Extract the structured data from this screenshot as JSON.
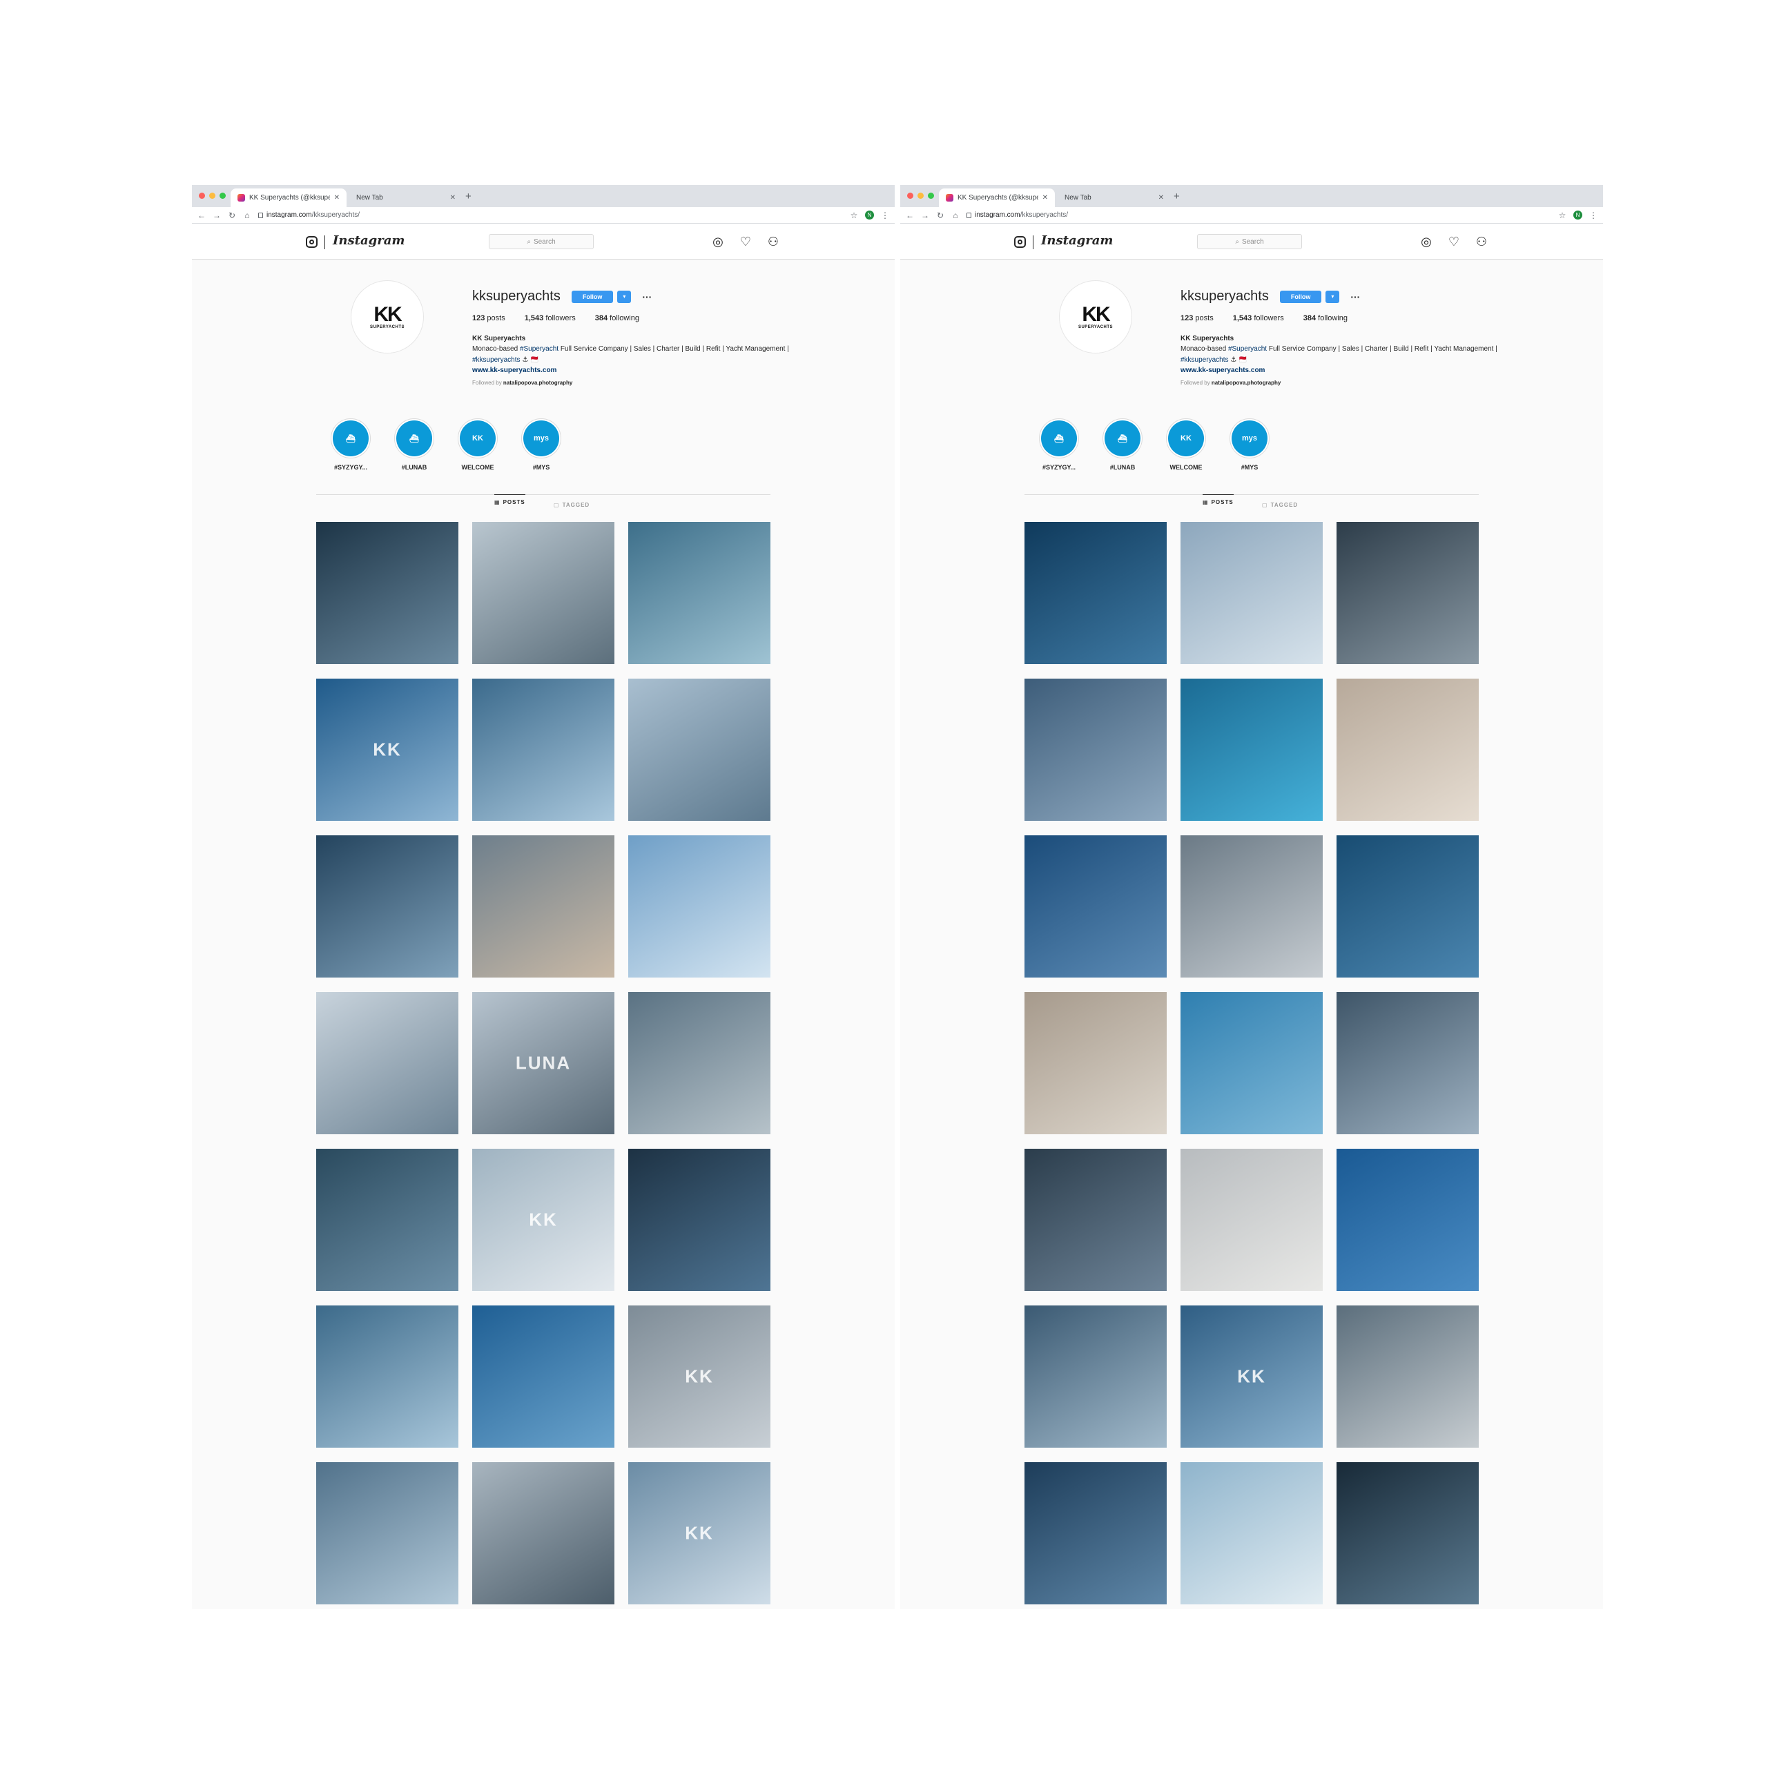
{
  "browser": {
    "active_tab_title": "KK Superyachts (@kksuperyac",
    "inactive_tab_title": "New Tab",
    "url_host": "instagram.com",
    "url_path": "/kksuperyachts/",
    "profile_initial": "N"
  },
  "instagram": {
    "logo_text": "Instagram",
    "search_placeholder": "Search"
  },
  "profile": {
    "username": "kksuperyachts",
    "follow_label": "Follow",
    "posts_count": "123",
    "posts_label": "posts",
    "followers_count": "1,543",
    "followers_label": "followers",
    "following_count": "384",
    "following_label": "following",
    "full_name": "KK Superyachts",
    "bio_part1": "Monaco-based ",
    "bio_tag1": "#Superyacht",
    "bio_part2": " Full Service Company | Sales | Charter | Build | Refit | Yacht Management | ",
    "bio_tag2": "#kksuperyachts",
    "bio_emoji": " ⚓ 🇲🇨",
    "website": "www.kk-superyachts.com",
    "followed_by_prefix": "Followed by ",
    "followed_by_user": "natalipopova.photography",
    "avatar_logo": "KK",
    "avatar_logo_sub": "SUPERYACHTS"
  },
  "highlights": [
    {
      "label": "#SYZYGY...",
      "glyph": "⛴"
    },
    {
      "label": "#LUNAB",
      "glyph": "⛴"
    },
    {
      "label": "WELCOME",
      "glyph": "KK"
    },
    {
      "label": "#MYS",
      "glyph": "mys"
    }
  ],
  "tabs": {
    "posts_label": "POSTS",
    "tagged_label": "TAGGED"
  },
  "grid_left": [
    {
      "colors": [
        "#1d3547",
        "#6b8aa0"
      ],
      "text": ""
    },
    {
      "colors": [
        "#b9c6cf",
        "#5c6f7c"
      ],
      "text": ""
    },
    {
      "colors": [
        "#3d6f8a",
        "#9fc3d3"
      ],
      "text": ""
    },
    {
      "colors": [
        "#1f5a8a",
        "#8fb6d4"
      ],
      "text": "KK"
    },
    {
      "colors": [
        "#3b6a8c",
        "#a9c7dc"
      ],
      "text": ""
    },
    {
      "colors": [
        "#a9bfd0",
        "#5e7a8f"
      ],
      "text": ""
    },
    {
      "colors": [
        "#24445e",
        "#7fa1ba"
      ],
      "text": ""
    },
    {
      "colors": [
        "#6e7f8c",
        "#c9b9a6"
      ],
      "text": ""
    },
    {
      "colors": [
        "#6f9fc7",
        "#d3e4f1"
      ],
      "text": ""
    },
    {
      "colors": [
        "#c8d3dc",
        "#6f8596"
      ],
      "text": ""
    },
    {
      "colors": [
        "#b7c4cf",
        "#5a6b78"
      ],
      "text": "LUNA"
    },
    {
      "colors": [
        "#5a7283",
        "#b6c2c9"
      ],
      "text": ""
    },
    {
      "colors": [
        "#2a4a5e",
        "#6d90a8"
      ],
      "text": ""
    },
    {
      "colors": [
        "#9fb3c1",
        "#e3e9ee"
      ],
      "text": "KK"
    },
    {
      "colors": [
        "#1d3244",
        "#4f7594"
      ],
      "text": ""
    },
    {
      "colors": [
        "#3c6a8a",
        "#a8c6da"
      ],
      "text": ""
    },
    {
      "colors": [
        "#1f5f94",
        "#6aa3cc"
      ],
      "text": ""
    },
    {
      "colors": [
        "#7e8c97",
        "#c8cfd5"
      ],
      "text": "KK"
    },
    {
      "colors": [
        "#51728b",
        "#b1c8d8"
      ],
      "text": ""
    },
    {
      "colors": [
        "#a8b5bf",
        "#4d5e6b"
      ],
      "text": ""
    },
    {
      "colors": [
        "#6b8ca5",
        "#cfdde8"
      ],
      "text": "KK"
    }
  ],
  "grid_right": [
    {
      "colors": [
        "#0f3a5c",
        "#3f7aa4"
      ],
      "text": ""
    },
    {
      "colors": [
        "#8da7bd",
        "#d6e2eb"
      ],
      "text": ""
    },
    {
      "colors": [
        "#2d3d4a",
        "#8a99a4"
      ],
      "text": ""
    },
    {
      "colors": [
        "#3d5d7a",
        "#8fa9c0"
      ],
      "text": ""
    },
    {
      "colors": [
        "#1b6b94",
        "#45b1d9"
      ],
      "text": ""
    },
    {
      "colors": [
        "#b7a99a",
        "#e6ddd2"
      ],
      "text": ""
    },
    {
      "colors": [
        "#1b4c7a",
        "#5c8bb5"
      ],
      "text": ""
    },
    {
      "colors": [
        "#6b7a86",
        "#c6ccd1"
      ],
      "text": ""
    },
    {
      "colors": [
        "#184c72",
        "#4b86b0"
      ],
      "text": ""
    },
    {
      "colors": [
        "#a69a8c",
        "#ddd6cc"
      ],
      "text": ""
    },
    {
      "colors": [
        "#2f7fb0",
        "#7fb9d9"
      ],
      "text": ""
    },
    {
      "colors": [
        "#3e5568",
        "#9eb1c1"
      ],
      "text": ""
    },
    {
      "colors": [
        "#2b3d4c",
        "#6e8498"
      ],
      "text": ""
    },
    {
      "colors": [
        "#b8bcbf",
        "#e8e8e6"
      ],
      "text": ""
    },
    {
      "colors": [
        "#1a5a94",
        "#4a8cc4"
      ],
      "text": ""
    },
    {
      "colors": [
        "#3b5a73",
        "#a2bacb"
      ],
      "text": ""
    },
    {
      "colors": [
        "#2f5e84",
        "#8cb3cf"
      ],
      "text": "KK"
    },
    {
      "colors": [
        "#5b6e7c",
        "#c7cdd1"
      ],
      "text": ""
    },
    {
      "colors": [
        "#1d3d5a",
        "#5f87a8"
      ],
      "text": ""
    },
    {
      "colors": [
        "#8fb4cc",
        "#e1ecf2"
      ],
      "text": ""
    },
    {
      "colors": [
        "#182a38",
        "#5b7a90"
      ],
      "text": ""
    }
  ]
}
